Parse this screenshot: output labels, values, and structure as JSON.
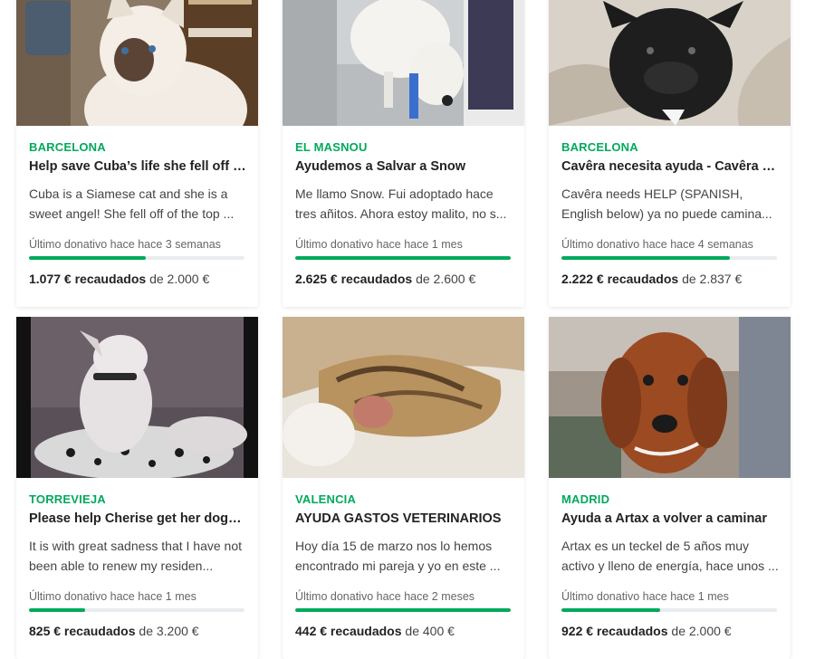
{
  "colors": {
    "accent": "#02a95c",
    "bar_bg": "#e9ecef"
  },
  "cards": [
    {
      "location": "BARCELONA",
      "title": "Help save Cuba’s life she fell off th...",
      "description": "Cuba is a Siamese cat and she is a sweet angel! She fell off of the top ...",
      "last_donation": "Último donativo hace hace 3 semanas",
      "raised_amount": "1.077 € recaudados",
      "goal_text": "de 2.000 €",
      "progress": 0.54,
      "image_desc": "siamese-cat-photo"
    },
    {
      "location": "EL MASNOU",
      "title": "Ayudemos a Salvar a Snow",
      "description": "Me llamo Snow. Fui adoptado hace tres añitos. Ahora estoy malito, no s...",
      "last_donation": "Último donativo hace hace 1 mes",
      "raised_amount": "2.625 € recaudados",
      "goal_text": "de 2.600 €",
      "progress": 1.0,
      "image_desc": "white-dog-vet-photo"
    },
    {
      "location": "BARCELONA",
      "title": "Cavêra necesita ayuda - Cavêra n...",
      "description": "Cavêra needs HELP (SPANISH, English below) ya no puede camina...",
      "last_donation": "Último donativo hace hace 4 semanas",
      "raised_amount": "2.222 € recaudados",
      "goal_text": "de 2.837 €",
      "progress": 0.78,
      "image_desc": "black-bulldog-photo"
    },
    {
      "location": "TORREVIEJA",
      "title": "Please help Cherise get her dogs t...",
      "description": "It is with great sadness that I have not been able to renew my residen...",
      "last_donation": "Último donativo hace hace 1 mes",
      "raised_amount": "825 € recaudados",
      "goal_text": "de 3.200 €",
      "progress": 0.26,
      "image_desc": "white-pitbull-photo"
    },
    {
      "location": "VALENCIA",
      "title": "AYUDA GASTOS VETERINARIOS",
      "description": "Hoy día 15 de marzo nos lo hemos encontrado mi pareja y yo en este ...",
      "last_donation": "Último donativo hace hace 2 meses",
      "raised_amount": "442 € recaudados",
      "goal_text": "de 400 €",
      "progress": 1.0,
      "image_desc": "injured-cat-photo"
    },
    {
      "location": "MADRID",
      "title": "Ayuda a Artax a volver a caminar",
      "description": "Artax es un teckel de 5 años muy activo y lleno de energía, hace unos ...",
      "last_donation": "Último donativo hace hace 1 mes",
      "raised_amount": "922 € recaudados",
      "goal_text": "de 2.000 €",
      "progress": 0.46,
      "image_desc": "dachshund-photo"
    }
  ]
}
